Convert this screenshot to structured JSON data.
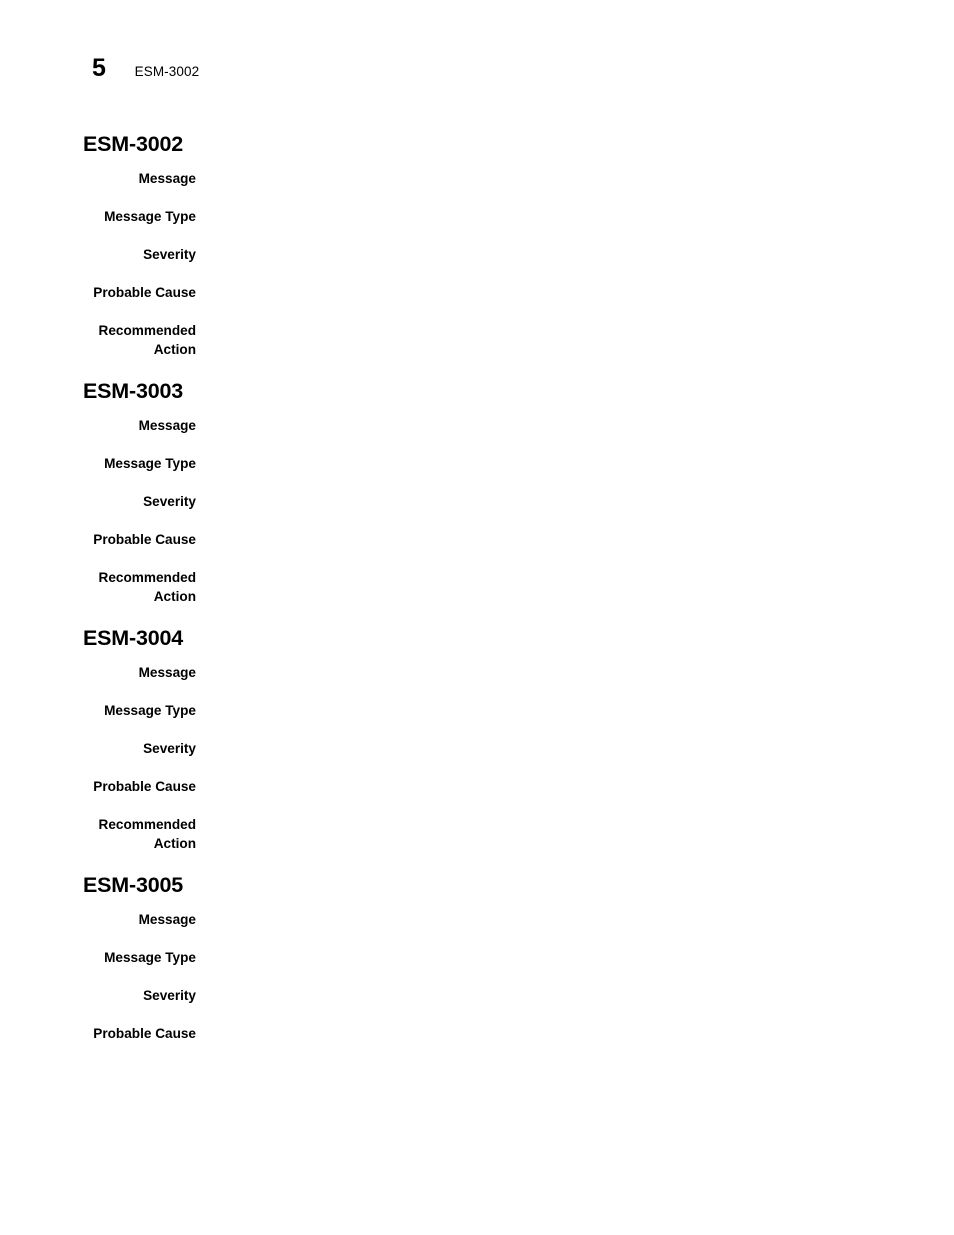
{
  "header": {
    "chapter_number": "5",
    "running_title": "ESM-3002"
  },
  "sections": [
    {
      "heading": "ESM-3002",
      "fields": [
        {
          "label": "Message",
          "value": ""
        },
        {
          "label": "Message Type",
          "value": ""
        },
        {
          "label": "Severity",
          "value": ""
        },
        {
          "label": "Probable Cause",
          "value": ""
        },
        {
          "label": "Recommended Action",
          "value": ""
        }
      ]
    },
    {
      "heading": "ESM-3003",
      "fields": [
        {
          "label": "Message",
          "value": ""
        },
        {
          "label": "Message Type",
          "value": ""
        },
        {
          "label": "Severity",
          "value": ""
        },
        {
          "label": "Probable Cause",
          "value": ""
        },
        {
          "label": "Recommended Action",
          "value": ""
        }
      ]
    },
    {
      "heading": "ESM-3004",
      "fields": [
        {
          "label": "Message",
          "value": ""
        },
        {
          "label": "Message Type",
          "value": ""
        },
        {
          "label": "Severity",
          "value": ""
        },
        {
          "label": "Probable Cause",
          "value": ""
        },
        {
          "label": "Recommended Action",
          "value": ""
        }
      ]
    },
    {
      "heading": "ESM-3005",
      "fields": [
        {
          "label": "Message",
          "value": ""
        },
        {
          "label": "Message Type",
          "value": ""
        },
        {
          "label": "Severity",
          "value": ""
        },
        {
          "label": "Probable Cause",
          "value": ""
        }
      ]
    }
  ]
}
